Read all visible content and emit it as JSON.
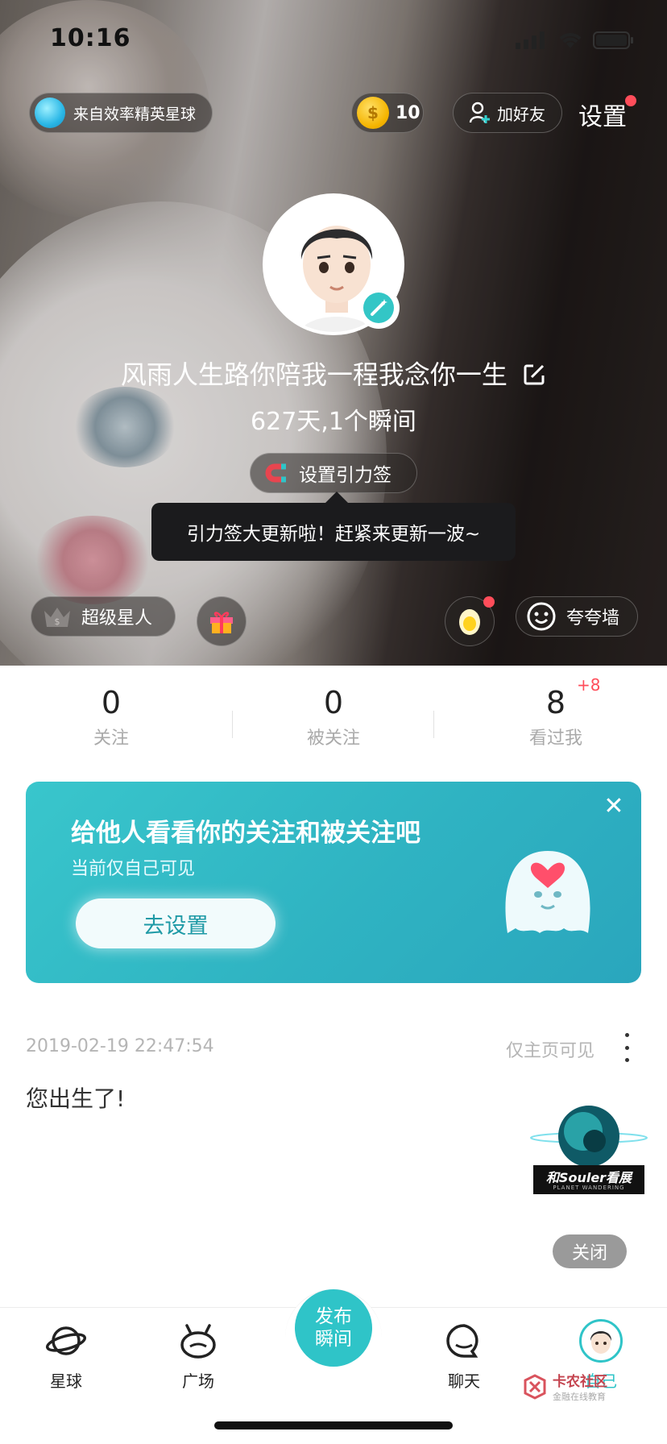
{
  "status_bar": {
    "time": "10:16"
  },
  "header": {
    "planet_label": "来自效率精英星球",
    "coin_symbol": "$",
    "coin_count": "10",
    "add_friend_label": "加好友",
    "settings_label": "设置"
  },
  "profile": {
    "name": "风雨人生路你陪我一程我念你一生",
    "stats_line": "627天,1个瞬间",
    "gravity_tag_label": "设置引力签",
    "tooltip": "引力签大更新啦！赶紧来更新一波~",
    "super_star_label": "超级星人",
    "praise_wall_label": "夸夸墙"
  },
  "counts": [
    {
      "value": "0",
      "label": "关注",
      "plus": ""
    },
    {
      "value": "0",
      "label": "被关注",
      "plus": ""
    },
    {
      "value": "8",
      "label": "看过我",
      "plus": "+8"
    }
  ],
  "banner": {
    "title": "给他人看看你的关注和被关注吧",
    "subtitle": "当前仅自己可见",
    "button": "去设置",
    "close": "✕"
  },
  "post": {
    "date": "2019-02-19 22:47:54",
    "visibility": "仅主页可见",
    "text": "您出生了!",
    "promo_text": "和Souler看展",
    "promo_sub": "PLANET WANDERING",
    "close_label": "关闭"
  },
  "tabbar": {
    "planet": "星球",
    "square": "广场",
    "publish": "发布瞬间",
    "chat": "聊天",
    "me": "自己"
  },
  "watermark": {
    "title": "卡农社区",
    "subtitle": "金融在线教育"
  },
  "colors": {
    "accent": "#2fc4c8",
    "badge_red": "#ff4d5a",
    "banner": "#33b9c5"
  }
}
